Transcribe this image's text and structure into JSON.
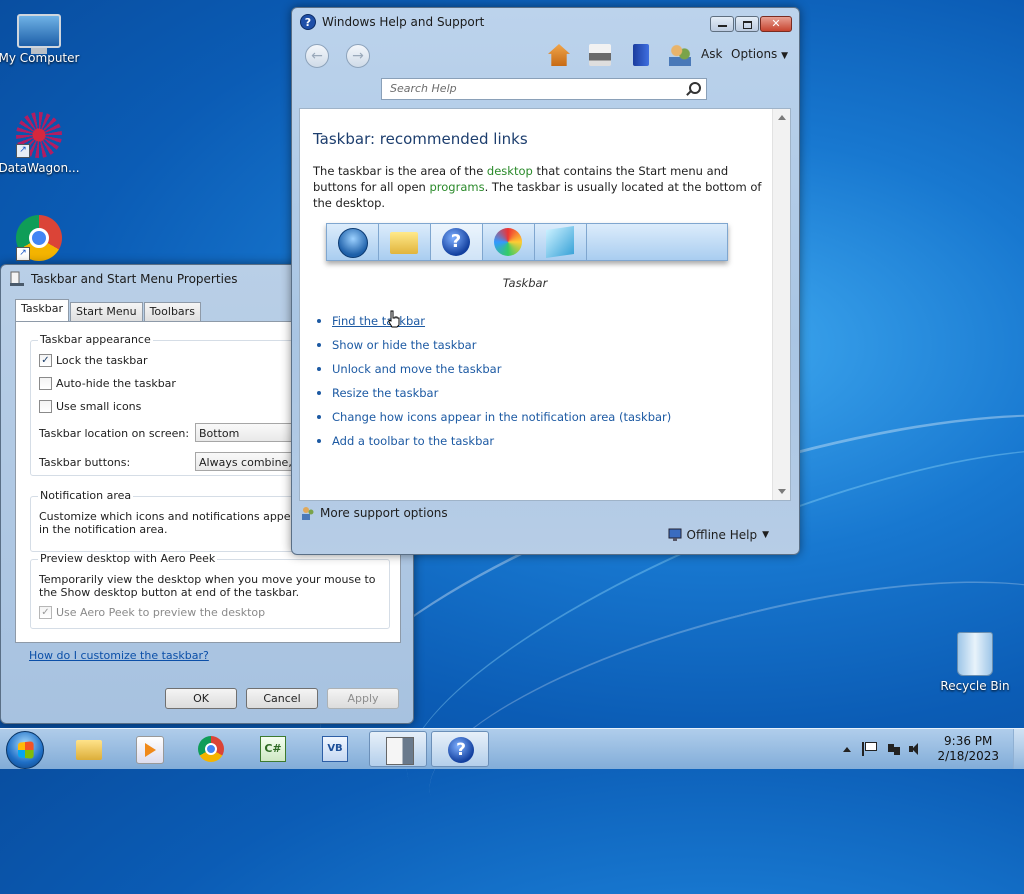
{
  "desktop": {
    "icons": {
      "my_computer": "My Computer",
      "datawagon": "DataWagon...",
      "recycle_bin": "Recycle Bin"
    }
  },
  "props_window": {
    "title": "Taskbar and Start Menu Properties",
    "tabs": [
      "Taskbar",
      "Start Menu",
      "Toolbars"
    ],
    "appearance": {
      "title": "Taskbar appearance",
      "lock": "Lock the taskbar",
      "lock_checked": true,
      "autohide": "Auto-hide the taskbar",
      "small_icons": "Use small icons",
      "location_label": "Taskbar location on screen:",
      "location_value": "Bottom",
      "buttons_label": "Taskbar buttons:",
      "buttons_value": "Always combine, hid"
    },
    "notification": {
      "title": "Notification area",
      "text": "Customize which icons and notifications appear in the notification area."
    },
    "aero": {
      "title": "Preview desktop with Aero Peek",
      "text": "Temporarily view the desktop when you move your mouse to the Show desktop button at end of the taskbar.",
      "checkbox": "Use Aero Peek to preview the desktop"
    },
    "help_link": "How do I customize the taskbar?",
    "buttons": {
      "ok": "OK",
      "cancel": "Cancel",
      "apply": "Apply"
    }
  },
  "help_window": {
    "title": "Windows Help and Support",
    "toolbar": {
      "ask": "Ask",
      "options": "Options"
    },
    "search_placeholder": "Search Help",
    "heading": "Taskbar: recommended links",
    "para": {
      "part1": "The taskbar is the area of the ",
      "kw1": "desktop",
      "part2": " that contains the Start menu and buttons for all open ",
      "kw2": "programs",
      "part3": ". The taskbar is usually located at the bottom of the desktop."
    },
    "illustration_caption": "Taskbar",
    "links": [
      "Find the taskbar",
      "Show or hide the taskbar",
      "Unlock and move the taskbar",
      "Resize the taskbar",
      "Change how icons appear in the notification area (taskbar)",
      "Add a toolbar to the taskbar"
    ],
    "more_support": "More support options",
    "offline_help": "Offline Help"
  },
  "taskbar": {
    "clock_time": "9:36 PM",
    "clock_date": "2/18/2023"
  },
  "colors": {
    "link": "#1d5aa3",
    "keyword": "#2a8a2a",
    "heading": "#1d3e6e"
  }
}
